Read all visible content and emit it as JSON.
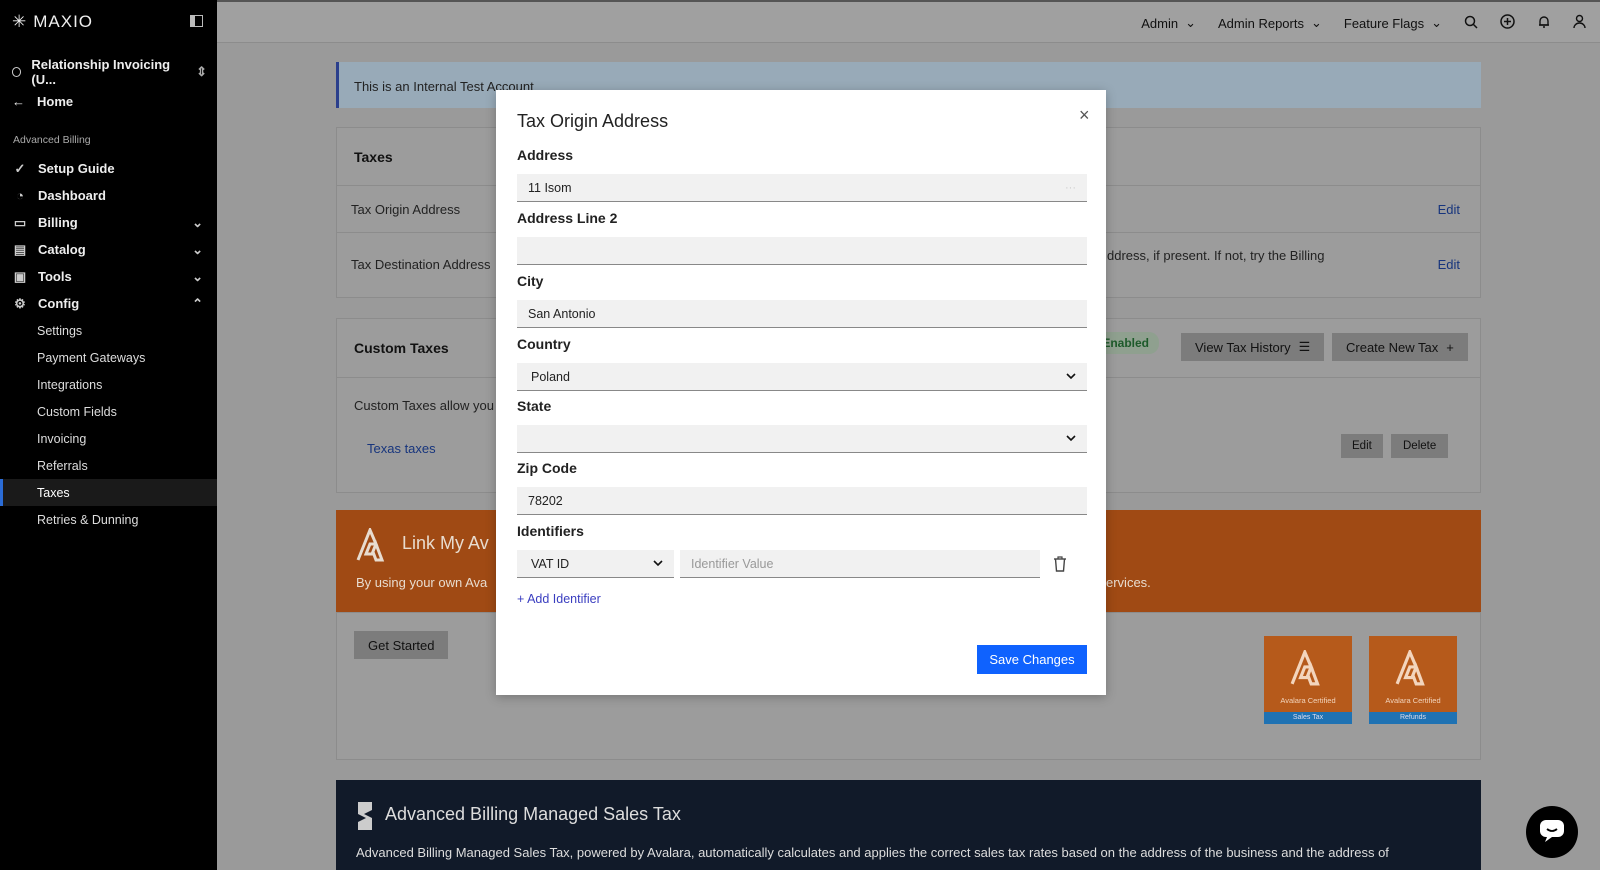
{
  "sidebar": {
    "brand": "MAXIO",
    "org": "Relationship Invoicing (U...",
    "home": "Home",
    "section": "Advanced Billing",
    "items": [
      {
        "label": "Setup Guide"
      },
      {
        "label": "Dashboard"
      },
      {
        "label": "Billing"
      },
      {
        "label": "Catalog"
      },
      {
        "label": "Tools"
      },
      {
        "label": "Config"
      }
    ],
    "config_sub": [
      "Settings",
      "Payment Gateways",
      "Integrations",
      "Custom Fields",
      "Invoicing",
      "Referrals",
      "Taxes",
      "Retries & Dunning"
    ],
    "active": "Taxes"
  },
  "topbar": {
    "admin": "Admin",
    "admin_reports": "Admin Reports",
    "feature_flags": "Feature Flags"
  },
  "banner": "This is an Internal Test Account",
  "taxes": {
    "title": "Taxes",
    "origin_label": "Tax Origin Address",
    "destination_label": "Tax Destination Address",
    "destination_desc": "ddress, if present. If not, try the Billing",
    "edit": "Edit"
  },
  "custom_taxes": {
    "title": "Custom Taxes",
    "status": ": Enabled",
    "view_history": "View Tax History",
    "create_new": "Create New Tax",
    "desc": "Custom Taxes allow you t",
    "tax_name": "Texas taxes",
    "edit": "Edit",
    "delete": "Delete"
  },
  "avalara": {
    "title": "Link My Av",
    "desc": "By using your own Ava",
    "desc_right": "ervices.",
    "get_started": "Get Started",
    "cert1_text": "Avalara Certified",
    "cert1_bar": "Sales Tax",
    "cert2_text": "Avalara Certified",
    "cert2_bar": "Refunds"
  },
  "managed": {
    "title": "Advanced Billing Managed Sales Tax",
    "desc": "Advanced Billing Managed Sales Tax, powered by Avalara, automatically calculates and applies the correct sales tax rates based on the address of the business and the address of"
  },
  "modal": {
    "title": "Tax Origin Address",
    "address_label": "Address",
    "address_value": "11 Isom",
    "address2_label": "Address Line 2",
    "address2_value": "",
    "city_label": "City",
    "city_value": "San Antonio",
    "country_label": "Country",
    "country_value": "Poland",
    "state_label": "State",
    "state_value": "",
    "zip_label": "Zip Code",
    "zip_value": "78202",
    "identifiers_label": "Identifiers",
    "identifier_type": "VAT ID",
    "identifier_placeholder": "Identifier Value",
    "add_identifier": "+ Add Identifier",
    "save": "Save Changes"
  }
}
